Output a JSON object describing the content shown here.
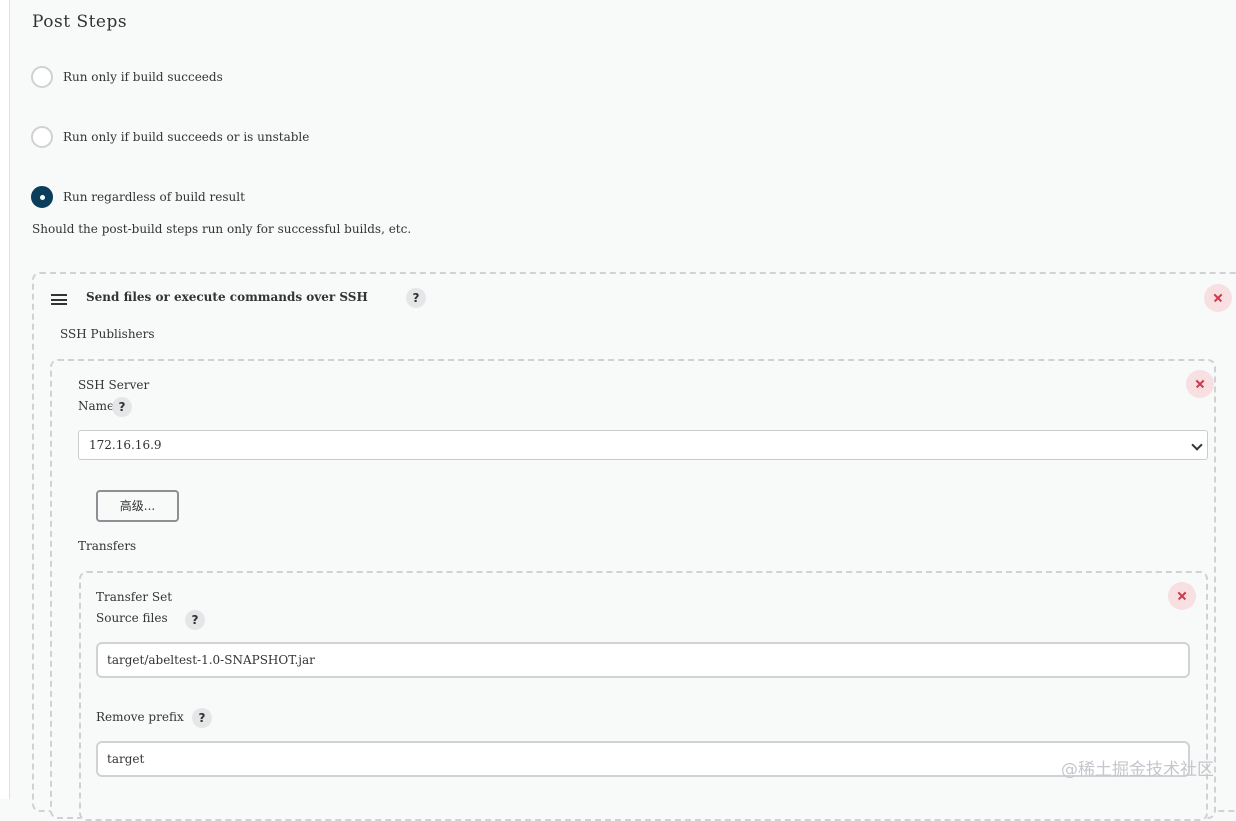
{
  "post_steps": {
    "title": "Post Steps",
    "options": [
      {
        "label": "Run only if build succeeds",
        "checked": false
      },
      {
        "label": "Run only if build succeeds or is unstable",
        "checked": false
      },
      {
        "label": "Run regardless of build result",
        "checked": true
      }
    ],
    "help_text": "Should the post-build steps run only for successful builds, etc."
  },
  "ssh_step": {
    "title": "Send files or execute commands over SSH",
    "help_icon": "?",
    "publishers_label": "SSH Publishers",
    "server": {
      "section_label": "SSH Server",
      "name_label": "Name",
      "name_help_icon": "?",
      "name_value": "172.16.16.9",
      "advanced_button": "高级..."
    },
    "transfers_label": "Transfers",
    "transfer_set": {
      "section_label": "Transfer Set",
      "source_files_label": "Source files",
      "source_files_help_icon": "?",
      "source_files_value": "target/abeltest-1.0-SNAPSHOT.jar",
      "remove_prefix_label": "Remove prefix",
      "remove_prefix_help_icon": "?",
      "remove_prefix_value": "target"
    }
  },
  "watermark": "@稀土掘金技术社区",
  "colors": {
    "accent": "#0b3d5c",
    "delete": "#d23a4b",
    "delete_bg": "#f7dfe2",
    "background": "#f8f9f9"
  }
}
